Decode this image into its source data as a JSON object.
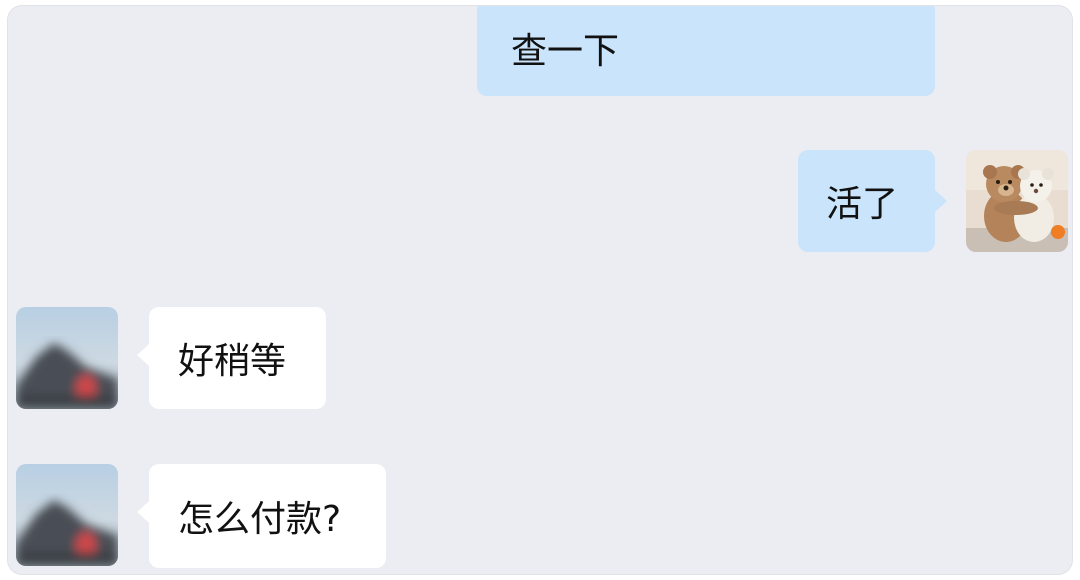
{
  "chat": {
    "messages": [
      {
        "sender": "self",
        "text": "查一下"
      },
      {
        "sender": "self",
        "text": "活了",
        "avatar_icon": "teddy-bears-avatar-icon"
      },
      {
        "sender": "other",
        "text": "好稍等",
        "avatar_icon": "blurred-landscape-avatar-icon"
      },
      {
        "sender": "other",
        "text": "怎么付款?",
        "avatar_icon": "blurred-landscape-avatar-icon"
      }
    ]
  },
  "colors": {
    "background": "#ecedf2",
    "self_bubble": "#c9e4fb",
    "other_bubble": "#ffffff",
    "text": "#111111"
  }
}
